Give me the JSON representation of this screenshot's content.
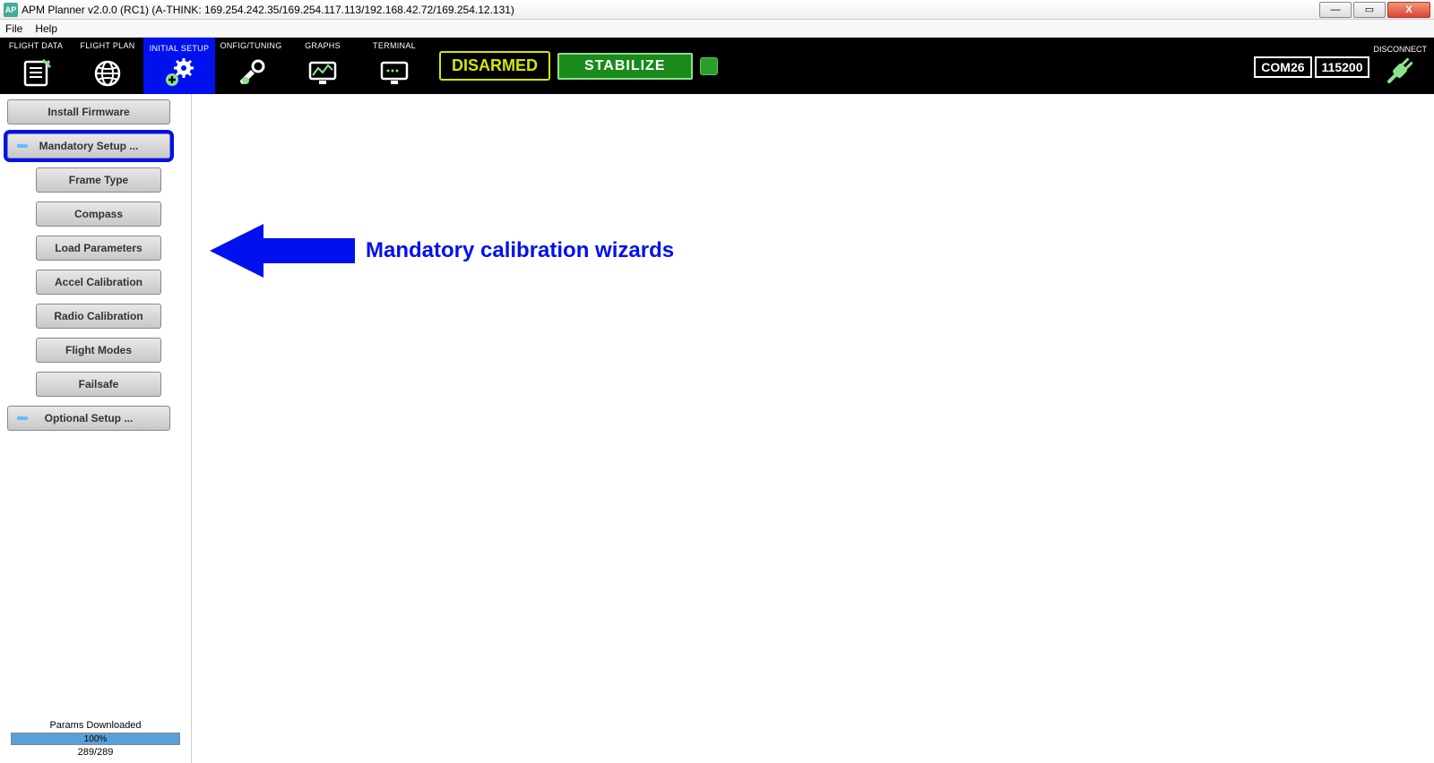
{
  "titlebar": {
    "title": "APM Planner v2.0.0 (RC1) (A-THINK: 169.254.242.35/169.254.117.113/192.168.42.72/169.254.12.131)"
  },
  "menubar": {
    "file": "File",
    "help": "Help"
  },
  "toolbar": {
    "tabs": [
      {
        "label": "FLIGHT DATA"
      },
      {
        "label": "FLIGHT PLAN"
      },
      {
        "label": "INITIAL SETUP"
      },
      {
        "label": "ONFIG/TUNING"
      },
      {
        "label": "GRAPHS"
      },
      {
        "label": "TERMINAL"
      }
    ],
    "armed_status": "DISARMED",
    "flight_mode": "STABILIZE",
    "connect_label": "DISCONNECT",
    "com_port": "COM26",
    "baud": "115200"
  },
  "sidebar": {
    "install_firmware": "Install Firmware",
    "mandatory_setup": "Mandatory Setup ...",
    "frame_type": "Frame Type",
    "compass": "Compass",
    "load_parameters": "Load Parameters",
    "accel_calibration": "Accel Calibration",
    "radio_calibration": "Radio Calibration",
    "flight_modes": "Flight Modes",
    "failsafe": "Failsafe",
    "optional_setup": "Optional Setup ...",
    "params_label": "Params Downloaded",
    "params_pct": "100%",
    "params_count": "289/289"
  },
  "annotation": {
    "text": "Mandatory calibration wizards"
  }
}
